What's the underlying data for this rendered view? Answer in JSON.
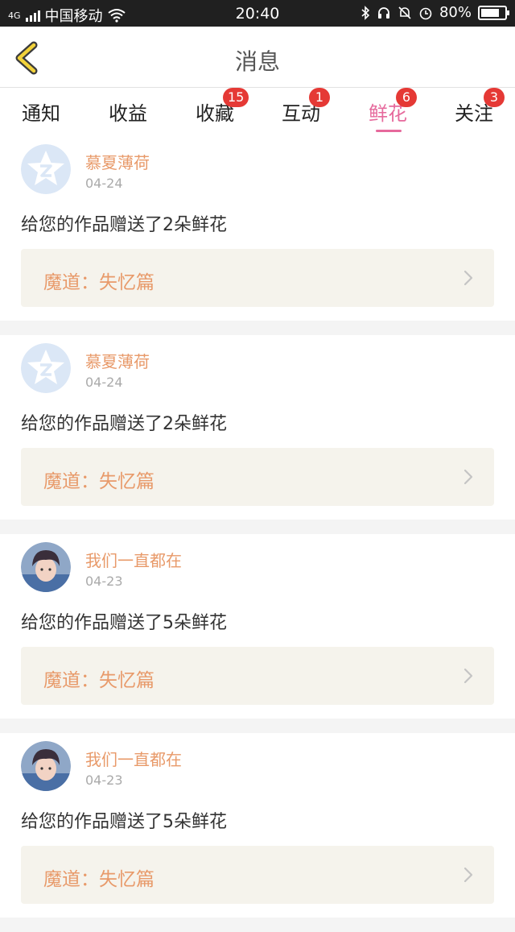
{
  "status_bar": {
    "network": "4G",
    "carrier": "中国移动",
    "time": "20:40",
    "battery": "80%",
    "battery_level": 0.8
  },
  "nav": {
    "title": "消息",
    "back_icon": "chevron-left-icon"
  },
  "tabs": [
    {
      "label": "通知",
      "badge": ""
    },
    {
      "label": "收益",
      "badge": ""
    },
    {
      "label": "收藏",
      "badge": "15"
    },
    {
      "label": "互动",
      "badge": "1"
    },
    {
      "label": "鲜花",
      "badge": "6",
      "active": true
    },
    {
      "label": "关注",
      "badge": "3"
    }
  ],
  "colors": {
    "accent": "#e6699c",
    "name": "#e89a6a",
    "badge": "#e53935"
  },
  "messages": [
    {
      "user": "慕夏薄荷",
      "date": "04-24",
      "text": "给您的作品赠送了2朵鲜花",
      "work": "魔道：失忆篇",
      "avatar": "qq-default-avatar"
    },
    {
      "user": "慕夏薄荷",
      "date": "04-24",
      "text": "给您的作品赠送了2朵鲜花",
      "work": "魔道：失忆篇",
      "avatar": "qq-default-avatar"
    },
    {
      "user": "我们一直都在",
      "date": "04-23",
      "text": "给您的作品赠送了5朵鲜花",
      "work": "魔道：失忆篇",
      "avatar": "photo-avatar"
    },
    {
      "user": "我们一直都在",
      "date": "04-23",
      "text": "给您的作品赠送了5朵鲜花",
      "work": "魔道：失忆篇",
      "avatar": "photo-avatar"
    }
  ]
}
